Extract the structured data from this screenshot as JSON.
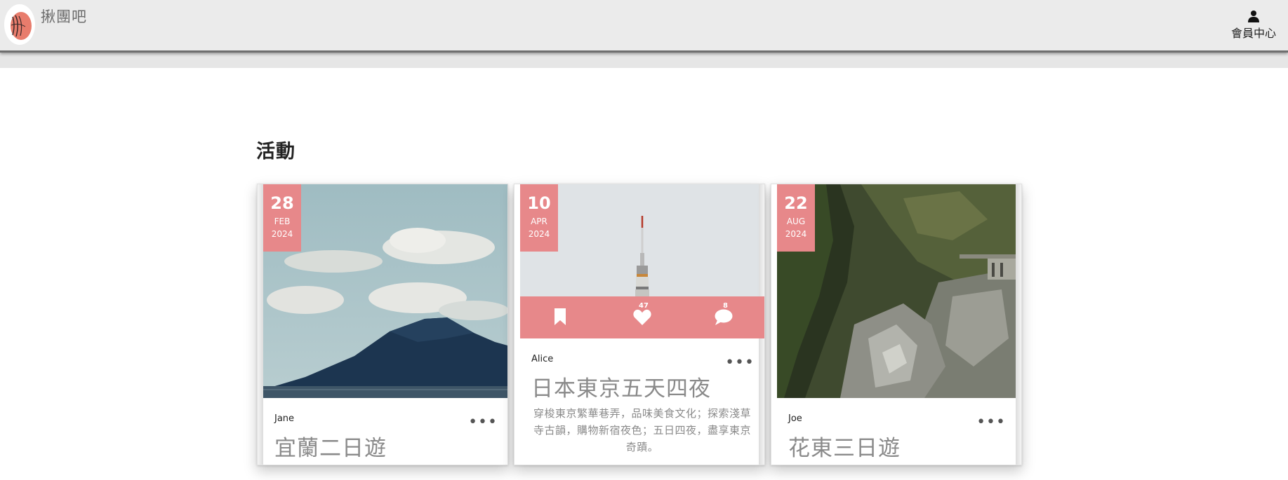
{
  "header": {
    "brand_name": "揪團吧",
    "member_label": "會員中心"
  },
  "section": {
    "title": "活動"
  },
  "cards": [
    {
      "day": "28",
      "month": "FEB",
      "year": "2024",
      "author": "Jane",
      "title": "宜蘭二日遊",
      "more": "•••"
    },
    {
      "day": "10",
      "month": "APR",
      "year": "2024",
      "author": "Alice",
      "title": "日本東京五天四夜",
      "description": "穿梭東京繁華巷弄，品味美食文化；探索淺草寺古韻，購物新宿夜色；五日四夜，盡享東京奇蹟。",
      "likes": "47",
      "comments": "8",
      "more": "•••"
    },
    {
      "day": "22",
      "month": "AUG",
      "year": "2024",
      "author": "Joe",
      "title": "花東三日遊",
      "more": "•••"
    }
  ],
  "icons": {
    "logo": "hand-drawn-logo-icon",
    "member": "user-icon",
    "bookmark": "bookmark-icon",
    "like": "heart-icon",
    "comment": "comment-icon"
  },
  "colors": {
    "accent": "#e7888a",
    "header_bg": "#ebebeb",
    "muted_text": "#8a8a8a"
  }
}
